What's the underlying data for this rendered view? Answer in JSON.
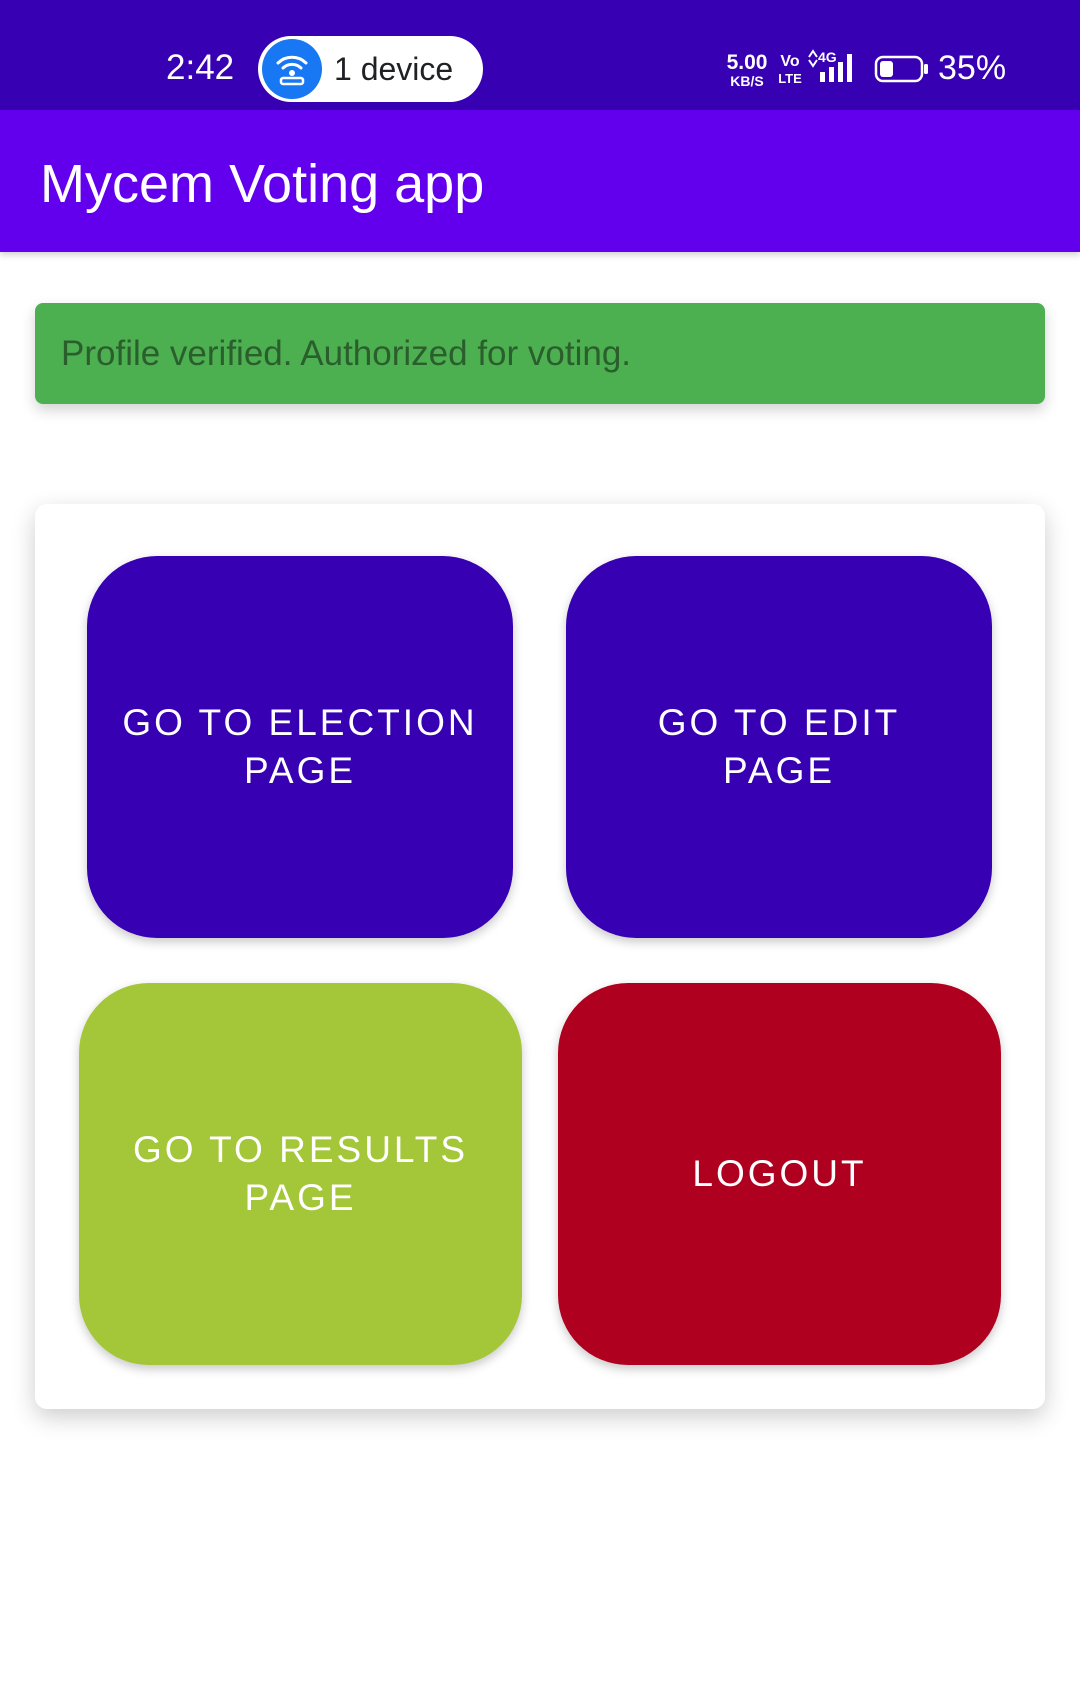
{
  "status_bar": {
    "time": "2:42",
    "hotspot_label": "1 device",
    "hotspot_icon": "wifi-hotspot-icon",
    "net_speed_value": "5.00",
    "net_speed_unit": "KB/S",
    "volte_top": "Vo",
    "volte_bottom": "LTE",
    "network_type": "4G",
    "battery_percent": "35%",
    "battery_level": 0.35
  },
  "app_bar": {
    "title": "Mycem Voting app"
  },
  "alert": {
    "message": "Profile verified. Authorized for voting.",
    "color": "#4caf50"
  },
  "actions": {
    "election": {
      "label": "GO TO ELECTION PAGE",
      "color": "#3700b3"
    },
    "edit": {
      "label": "GO TO EDIT PAGE",
      "color": "#3700b3"
    },
    "results": {
      "label": "GO TO RESULTS PAGE",
      "color": "#a4c639"
    },
    "logout": {
      "label": "LOGOUT",
      "color": "#b00020"
    }
  },
  "colors": {
    "status_bar": "#3700b3",
    "app_bar": "#6200ee",
    "background": "#ffffff"
  }
}
